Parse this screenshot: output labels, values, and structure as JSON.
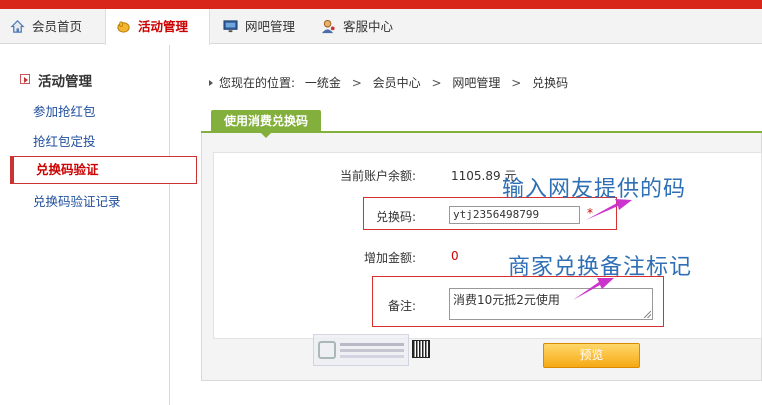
{
  "nav": {
    "items": [
      {
        "label": "会员首页",
        "icon": "home-icon"
      },
      {
        "label": "活动管理",
        "icon": "hand-icon",
        "active": true
      },
      {
        "label": "网吧管理",
        "icon": "monitor-icon"
      },
      {
        "label": "客服中心",
        "icon": "support-icon"
      }
    ]
  },
  "sidebar": {
    "title": "活动管理",
    "items": [
      {
        "label": "参加抢红包"
      },
      {
        "label": "抢红包定投"
      },
      {
        "label": "兑换码验证",
        "active": true
      },
      {
        "label": "兑换码验证记录"
      }
    ]
  },
  "breadcrumb": {
    "prefix": "您现在的位置:",
    "items": [
      "一统金",
      "会员中心",
      "网吧管理",
      "兑换码"
    ],
    "separator": ">"
  },
  "tab": {
    "label": "使用消费兑换码"
  },
  "form": {
    "balance_label": "当前账户余额:",
    "balance_value": "1105.89 元",
    "code_label": "兑换码:",
    "code_value": "ytj2356498799",
    "required_mark": "*",
    "increase_label": "增加金额:",
    "increase_value": "0",
    "note_label": "备注:",
    "note_value": "消费10元抵2元使用"
  },
  "annotations": {
    "code_hint": "输入网友提供的码",
    "note_hint": "商家兑换备注标记"
  },
  "button": {
    "preview_label": "预览"
  },
  "colors": {
    "top_bar": "#d8261b",
    "tab_green": "#83b03c",
    "link_blue": "#1f4e9c",
    "highlight_red": "#d83030",
    "annotation_blue": "#2f6fb5",
    "arrow_magenta": "#cc33cc",
    "button_orange": "#f6a914"
  }
}
